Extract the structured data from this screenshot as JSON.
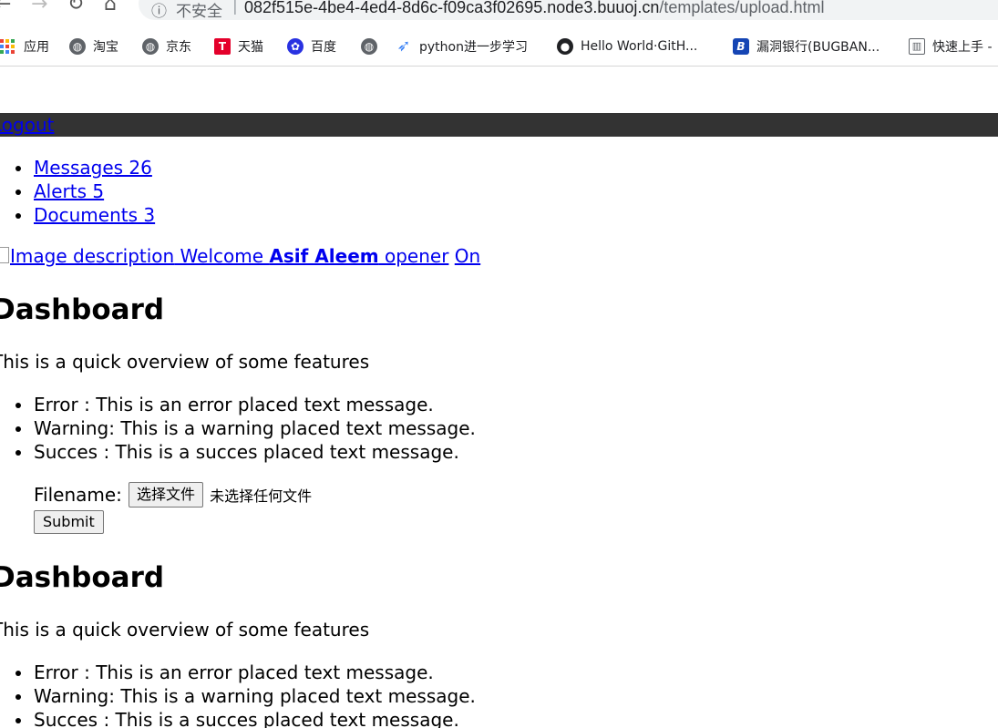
{
  "browser": {
    "back_icon": "back-arrow-icon",
    "forward_icon": "forward-arrow-icon",
    "reload_icon": "reload-icon",
    "home_icon": "home-icon",
    "insecure_label": "不安全",
    "url_host": "082f515e-4be4-4ed4-8d6c-f09ca3f02695.node3.buuoj.cn",
    "url_path": "/templates/upload.html",
    "bookmarks": [
      {
        "label": "应用",
        "icon": "apps-grid-icon"
      },
      {
        "label": "淘宝",
        "icon": "globe-icon"
      },
      {
        "label": "京东",
        "icon": "globe-icon"
      },
      {
        "label": "天猫",
        "icon": "tmall-icon"
      },
      {
        "label": "百度",
        "icon": "baidu-paw-icon"
      },
      {
        "label": "",
        "icon": "globe-icon"
      },
      {
        "label": "python进一步学习",
        "icon": "rocket-icon"
      },
      {
        "label": "Hello World·GitH...",
        "icon": "github-icon"
      },
      {
        "label": "漏洞银行(BUGBAN...",
        "icon": "bugbank-icon"
      },
      {
        "label": "快速上手 -",
        "icon": "document-icon"
      }
    ]
  },
  "page": {
    "logout": "Logout",
    "nav": [
      {
        "label": "Messages 26"
      },
      {
        "label": "Alerts 5"
      },
      {
        "label": "Documents 3"
      }
    ],
    "welcome": {
      "img_alt": "Image description",
      "welcome": " Welcome ",
      "user_name": "Asif Aleem",
      "user_role": " opener",
      "status": "On"
    },
    "sections": [
      {
        "title": "Dashboard",
        "subtitle": "This is a quick overview of some features",
        "messages": [
          "Error : This is an error placed text message.",
          "Warning: This is a warning placed text message.",
          "Succes : This is a succes placed text message."
        ]
      },
      {
        "title": "Dashboard",
        "subtitle": "This is a quick overview of some features",
        "messages": [
          "Error : This is an error placed text message.",
          "Warning: This is a warning placed text message.",
          "Succes : This is a succes placed text message."
        ]
      }
    ],
    "upload": {
      "filename_label": "Filename:",
      "choose_file": "选择文件",
      "no_file": "未选择任何文件",
      "submit": "Submit"
    }
  }
}
